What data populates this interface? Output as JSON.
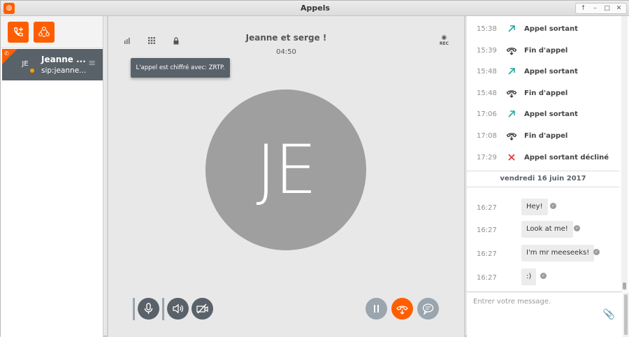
{
  "window": {
    "title": "Appels",
    "controls": [
      "↑",
      "–",
      "□",
      "✕"
    ]
  },
  "colors": {
    "accent": "#ff5e00",
    "contact_bg": "#596169",
    "avatar_grey": "#9f9f9f",
    "outgoing_teal": "#2aa6a0",
    "declined_red": "#e53935"
  },
  "sidebar": {
    "new_call_icon": "new-call-icon",
    "new_conference_icon": "conference-icon",
    "contact": {
      "initials": "JE",
      "name": "Jeanne ...",
      "address": "sip:jeanne...",
      "menu_icon": "≡"
    }
  },
  "call": {
    "title": "Jeanne et serge !",
    "duration": "04:50",
    "rec_label": "REC",
    "tooltip": "L'appel est chiffré avec: ZRTP.",
    "avatar_initials": "JE",
    "header_icons": [
      "signal-icon",
      "dialpad-icon",
      "lock-icon"
    ]
  },
  "history": [
    {
      "time": "15:38",
      "label": "Appel sortant",
      "kind": "outgoing"
    },
    {
      "time": "15:39",
      "label": "Fin d'appel",
      "kind": "end"
    },
    {
      "time": "15:48",
      "label": "Appel sortant",
      "kind": "outgoing"
    },
    {
      "time": "15:48",
      "label": "Fin d'appel",
      "kind": "end"
    },
    {
      "time": "17:06",
      "label": "Appel sortant",
      "kind": "outgoing"
    },
    {
      "time": "17:08",
      "label": "Fin d'appel",
      "kind": "end"
    },
    {
      "time": "17:29",
      "label": "Appel sortant décliné",
      "kind": "declined"
    }
  ],
  "date_separator": "vendredi 16 juin 2017",
  "messages": [
    {
      "time": "16:27",
      "text": "Hey!"
    },
    {
      "time": "16:27",
      "text": "Look at me!"
    },
    {
      "time": "16:27",
      "text": "I'm mr meeseeks!"
    },
    {
      "time": "16:27",
      "text": ":)"
    }
  ],
  "composer": {
    "placeholder": "Entrer votre message."
  }
}
